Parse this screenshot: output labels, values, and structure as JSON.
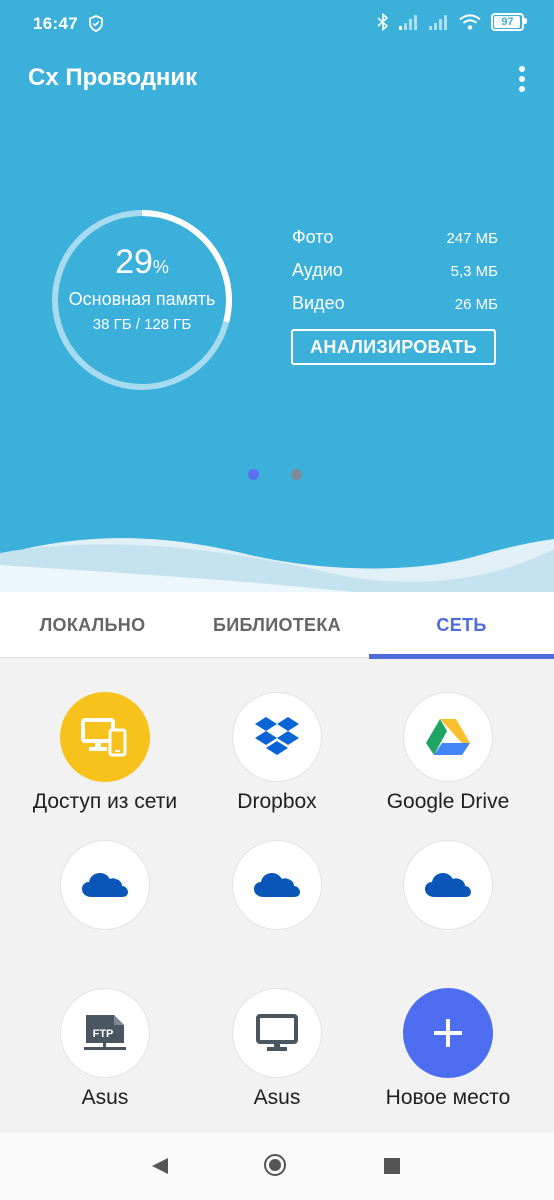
{
  "status_bar": {
    "time": "16:47",
    "battery": "97",
    "icons": [
      "shield-icon",
      "bluetooth-icon",
      "signal-icon",
      "signal-icon",
      "wifi-icon",
      "battery-icon"
    ]
  },
  "app": {
    "title": "Сх Проводник",
    "accent_color": "#3ab0db"
  },
  "storage": {
    "percent": "29",
    "percent_sign": "%",
    "percent_value": 0.29,
    "name": "Основная память",
    "capacity": "38 ГБ / 128 ГБ"
  },
  "stats": [
    {
      "label": "Фото",
      "value": "247 МБ"
    },
    {
      "label": "Аудио",
      "value": "5,3 МБ"
    },
    {
      "label": "Видео",
      "value": "26 МБ"
    }
  ],
  "analyze_label": "АНАЛИЗИРОВАТЬ",
  "pager": {
    "count": 2,
    "active": 0
  },
  "tabs": [
    {
      "label": "ЛОКАЛЬНО",
      "active": false
    },
    {
      "label": "БИБЛИОТЕКА",
      "active": false
    },
    {
      "label": "СЕТЬ",
      "active": true
    }
  ],
  "network_items": [
    {
      "label": "Доступ из сети",
      "icon": "remote-access-icon"
    },
    {
      "label": "Dropbox",
      "icon": "dropbox-icon"
    },
    {
      "label": "Google Drive",
      "icon": "google-drive-icon"
    },
    {
      "label": "",
      "icon": "onedrive-icon"
    },
    {
      "label": "",
      "icon": "onedrive-icon"
    },
    {
      "label": "",
      "icon": "onedrive-icon"
    },
    {
      "label": "Asus",
      "icon": "ftp-icon"
    },
    {
      "label": "Asus",
      "icon": "monitor-icon"
    },
    {
      "label": "Новое место",
      "icon": "plus-icon"
    }
  ],
  "navbar": {
    "icons": [
      "back-icon",
      "home-icon",
      "recent-apps-icon"
    ]
  }
}
